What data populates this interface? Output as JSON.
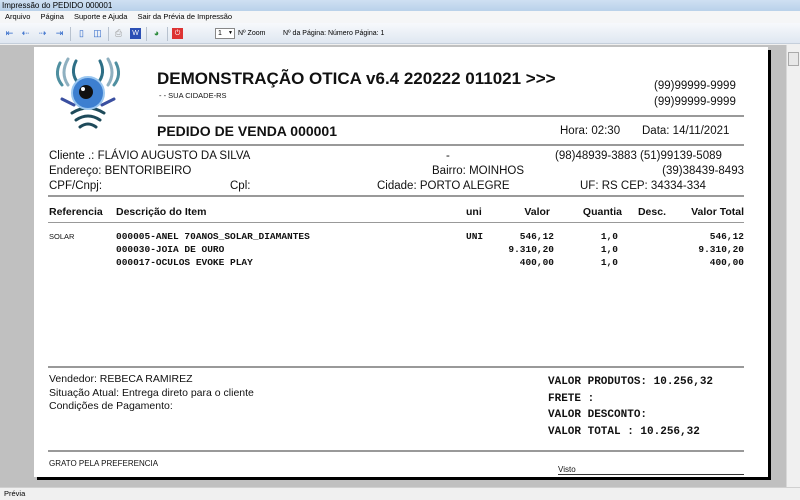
{
  "window": {
    "title": "Impressão do PEDIDO 000001"
  },
  "menu": [
    "Arquivo",
    "Página",
    "Suporte e Ajuda",
    "Sair da Prévia de Impressão"
  ],
  "toolbar": {
    "zoom_value": "1",
    "zoom_label": "Nº Zoom",
    "page_label": "Nº da Página: Número Página: 1"
  },
  "status": "Prévia",
  "header": {
    "company": "DEMONSTRAÇÃO OTICA v6.4 220222 011021 >>>",
    "city": "- - SUA CIDADE-RS",
    "phone1": "(99)99999-9999",
    "phone2": "(99)99999-9999",
    "order_title": "PEDIDO DE VENDA 000001",
    "hora": "Hora: 02:30",
    "data": "Data: 14/11/2021"
  },
  "client": {
    "name": "Cliente   .: FLÁVIO AUGUSTO DA SILVA",
    "dash": "-",
    "phones": "(98)48939-3883  (51)99139-5089",
    "address": "Endereço: BENTORIBEIRO",
    "bairro": "Bairro: MOINHOS",
    "phone3": "(39)38439-8493",
    "cpf": "CPF/Cnpj:",
    "cpl": "Cpl:",
    "cidade": "Cidade: PORTO ALEGRE",
    "uf": "UF: RS  CEP: 34334-334"
  },
  "table": {
    "headers": [
      "Referencia",
      "Descrição do Item",
      "uni",
      "Valor",
      "Quantia",
      "Desc.",
      "Valor Total"
    ],
    "rows": [
      {
        "ref": "SOLAR",
        "desc": "000005-ANEL 70ANOS_SOLAR_DIAMANTES",
        "uni": "UNI",
        "valor": "546,12",
        "qtd": "1,0",
        "desc_val": "",
        "total": "546,12"
      },
      {
        "ref": "",
        "desc": "000030-JOIA DE OURO",
        "uni": "",
        "valor": "9.310,20",
        "qtd": "1,0",
        "desc_val": "",
        "total": "9.310,20"
      },
      {
        "ref": "",
        "desc": "000017-OCULOS EVOKE PLAY",
        "uni": "",
        "valor": "400,00",
        "qtd": "1,0",
        "desc_val": "",
        "total": "400,00"
      }
    ]
  },
  "footer": {
    "vendedor": "Vendedor: REBECA RAMIREZ",
    "situacao": "Situação Atual: Entrega direto para o cliente",
    "condicoes": "Condições de Pagamento:",
    "valor_produtos": "VALOR PRODUTOS: 10.256,32",
    "frete": "FRETE          :",
    "desconto": "VALOR DESCONTO:",
    "total": "VALOR TOTAL    : 10.256,32",
    "grato": "GRATO PELA PREFERENCIA",
    "visto": "Visto"
  }
}
